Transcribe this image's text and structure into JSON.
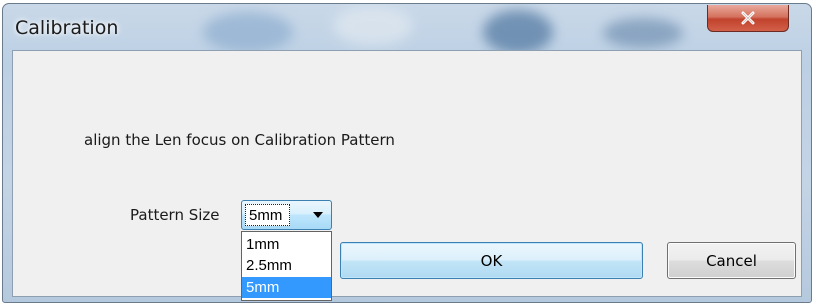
{
  "window": {
    "title": "Calibration",
    "close_icon": "close-icon"
  },
  "dialog": {
    "instruction": "align the Len focus on Calibration Pattern",
    "pattern_size_label": "Pattern Size",
    "pattern_size_selected": "5mm",
    "pattern_size_options": [
      "1mm",
      "2.5mm",
      "5mm"
    ],
    "ok_label": "OK",
    "cancel_label": "Cancel"
  },
  "colors": {
    "close_button": "#c1432d",
    "selection_highlight": "#3399ff",
    "focused_border": "#3c7fb1"
  }
}
